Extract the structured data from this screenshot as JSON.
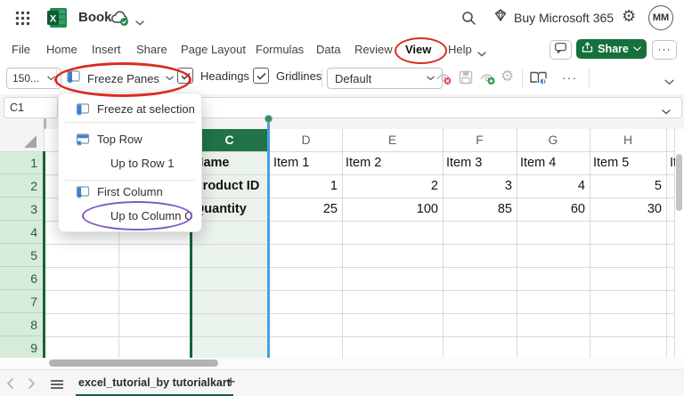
{
  "topbar": {
    "title": "Book",
    "buy_label": "Buy Microsoft 365",
    "avatar": "MM"
  },
  "menubar": {
    "items": [
      "File",
      "Home",
      "Insert",
      "Share",
      "Page Layout",
      "Formulas",
      "Data",
      "Review",
      "View",
      "Help"
    ],
    "active_item": "View",
    "share_label": "Share",
    "more_label": "···"
  },
  "toolbar": {
    "zoom_value": "150...",
    "freeze_label": "Freeze Panes",
    "headings_label": "Headings",
    "gridlines_label": "Gridlines",
    "view_select_value": "Default",
    "more_label": "···"
  },
  "formula_bar": {
    "name_box": "C1"
  },
  "freeze_menu": {
    "items": [
      "Freeze at selection",
      "Top Row",
      "Up to Row 1",
      "First Column",
      "Up to Column C"
    ]
  },
  "grid": {
    "col_headers": [
      "C",
      "D",
      "E",
      "F",
      "G",
      "H"
    ],
    "row_numbers": [
      "1",
      "2",
      "3",
      "4",
      "5",
      "6",
      "7",
      "8",
      "9"
    ],
    "rows": [
      {
        "c": "Name",
        "d": "Item 1",
        "e": "Item 2",
        "f": "Item 3",
        "g": "Item 4",
        "h": "Item 5",
        "i": "Ite"
      },
      {
        "c": "Product ID",
        "d": "1",
        "e": "2",
        "f": "3",
        "g": "4",
        "h": "5",
        "i": ""
      },
      {
        "c": "Quantity",
        "d": "25",
        "e": "100",
        "f": "85",
        "g": "60",
        "h": "30",
        "i": ""
      }
    ]
  },
  "sheet_bar": {
    "sheet_name": "excel_tutorial_by tutorialkart",
    "add_label": "+"
  },
  "icons": {
    "gear": "⚙"
  },
  "colors": {
    "excel_green": "#217346",
    "share_green": "#15703c",
    "annotation_red": "#d92b20",
    "annotation_purple": "#7e57c5",
    "freeze_blue": "#4a9ee0",
    "column_fill": "#eaf2ec",
    "rowheader_fill": "#d6ebdc"
  }
}
